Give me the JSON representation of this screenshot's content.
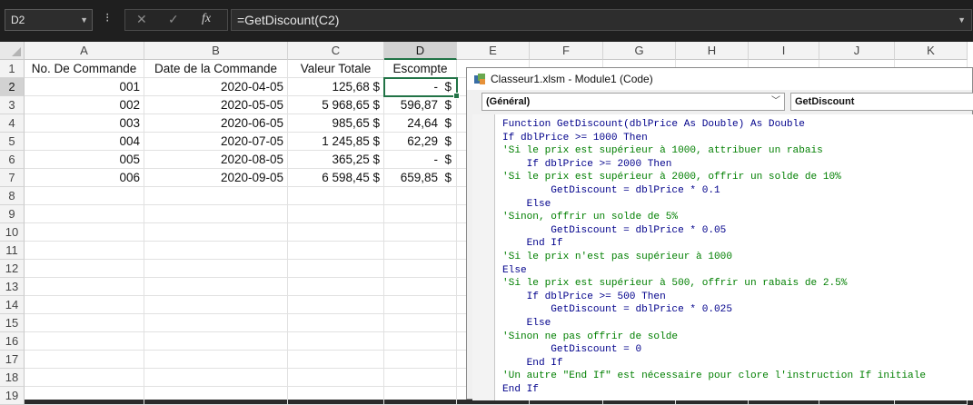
{
  "namebox": {
    "value": "D2"
  },
  "formula_bar": {
    "formula": "=GetDiscount(C2)",
    "cancel_glyph": "✕",
    "enter_glyph": "✓",
    "fx_glyph": "fx"
  },
  "columns": [
    "A",
    "B",
    "C",
    "D",
    "E",
    "F",
    "G",
    "H",
    "I",
    "J",
    "K"
  ],
  "rows": [
    "1",
    "2",
    "3",
    "4",
    "5",
    "6",
    "7",
    "8",
    "9",
    "10",
    "11",
    "12",
    "13",
    "14",
    "15",
    "16",
    "17",
    "18",
    "19"
  ],
  "headers": [
    "No. De Commande",
    "Date de la Commande",
    "Valeur Totale",
    "Escompte"
  ],
  "data_rows": [
    {
      "order": "001",
      "date": "2020-04-05",
      "total": "125,68 $",
      "disc": "-",
      "cur": "$"
    },
    {
      "order": "002",
      "date": "2020-05-05",
      "total": "5 968,65 $",
      "disc": "596,87",
      "cur": "$"
    },
    {
      "order": "003",
      "date": "2020-06-05",
      "total": "985,65 $",
      "disc": "24,64",
      "cur": "$"
    },
    {
      "order": "004",
      "date": "2020-07-05",
      "total": "1 245,85 $",
      "disc": "62,29",
      "cur": "$"
    },
    {
      "order": "005",
      "date": "2020-08-05",
      "total": "365,25 $",
      "disc": "-",
      "cur": "$"
    },
    {
      "order": "006",
      "date": "2020-09-05",
      "total": "6 598,45 $",
      "disc": "659,85",
      "cur": "$"
    }
  ],
  "selected_cell": "D2",
  "vbe": {
    "title": "Classeur1.xlsm - Module1 (Code)",
    "object_combo": "(Général)",
    "proc_combo": "GetDiscount",
    "code_lines": [
      {
        "t": "Function GetDiscount(dblPrice As Double) As Double",
        "k": "kw"
      },
      {
        "t": "If dblPrice >= 1000 Then",
        "k": "kw"
      },
      {
        "t": "'Si le prix est supérieur à 1000, attribuer un rabais",
        "k": "cm"
      },
      {
        "t": "    If dblPrice >= 2000 Then",
        "k": "kw"
      },
      {
        "t": "'Si le prix est supérieur à 2000, offrir un solde de 10%",
        "k": "cm"
      },
      {
        "t": "        GetDiscount = dblPrice * 0.1",
        "k": "tx"
      },
      {
        "t": "    Else",
        "k": "kw"
      },
      {
        "t": "'Sinon, offrir un solde de 5%",
        "k": "cm"
      },
      {
        "t": "        GetDiscount = dblPrice * 0.05",
        "k": "tx"
      },
      {
        "t": "    End If",
        "k": "kw"
      },
      {
        "t": "'Si le prix n'est pas supérieur à 1000",
        "k": "cm"
      },
      {
        "t": "Else",
        "k": "kw"
      },
      {
        "t": "'Si le prix est supérieur à 500, offrir un rabais de 2.5%",
        "k": "cm"
      },
      {
        "t": "    If dblPrice >= 500 Then",
        "k": "kw"
      },
      {
        "t": "        GetDiscount = dblPrice * 0.025",
        "k": "tx"
      },
      {
        "t": "    Else",
        "k": "kw"
      },
      {
        "t": "'Sinon ne pas offrir de solde",
        "k": "cm"
      },
      {
        "t": "        GetDiscount = 0",
        "k": "tx"
      },
      {
        "t": "    End If",
        "k": "kw"
      },
      {
        "t": "'Un autre \"End If\" est nécessaire pour clore l'instruction If initiale",
        "k": "cm"
      },
      {
        "t": "End If",
        "k": "kw"
      }
    ]
  },
  "colors": {
    "accent": "#217346",
    "keyword": "#00008b",
    "comment": "#007f00"
  }
}
